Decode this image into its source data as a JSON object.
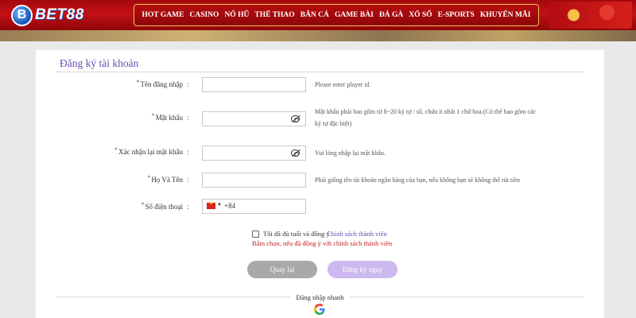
{
  "header": {
    "logo_badge": "B",
    "logo_text": "BET88",
    "nav": [
      "HOT GAME",
      "CASINO",
      "NỔ HŨ",
      "THỂ THAO",
      "BẮN CÁ",
      "GAME BÀI",
      "ĐÁ GÀ",
      "XỔ SỐ",
      "E-SPORTS",
      "KHUYẾN MÃI"
    ]
  },
  "form": {
    "title": "Đăng ký tài khoản",
    "colon": ":",
    "fields": {
      "username": {
        "label": "Tên đăng nhập",
        "value": "",
        "hint": "Please enter player id"
      },
      "password": {
        "label": "Mật khẩu",
        "value": "",
        "hint_line1": "Mật khẩu phải bao gồm từ 8~20 ký tự / số, chứa ít nhất 1 chữ hoa.(Có thể bao gồm các",
        "hint_line2": "ký tự đặc biệt)"
      },
      "confirm": {
        "label": "Xác nhận lại mật khẩu",
        "value": "",
        "hint": "Vui lòng nhập lại mật khẩu."
      },
      "fullname": {
        "label": "Họ Và Tên",
        "value": "",
        "hint": "Phải giống tên tài khoản ngân hàng của bạn, nếu không bạn sẽ không thể rút tiền"
      },
      "phone": {
        "label": "Số điện thoại",
        "country_code": "+84",
        "flag": "vn-flag"
      }
    },
    "agree": {
      "checked": false,
      "text": "Tôi đã đủ tuổi và đồng ý",
      "link": "Chính sách thành viên",
      "error": "Bấm chọn, nếu đã đồng ý với chính sách thành viên"
    },
    "buttons": {
      "back": "Quay lại",
      "register": "Đăng ký ngay"
    },
    "quick_login": "Đăng nhập nhanh",
    "required_mark": "*"
  },
  "colors": {
    "header_red": "#c21116",
    "accent_purple": "#6b4bb0",
    "error_red": "#c21e1e",
    "button_gray": "#a9a9a9",
    "button_lavender": "#cbb9f0"
  }
}
